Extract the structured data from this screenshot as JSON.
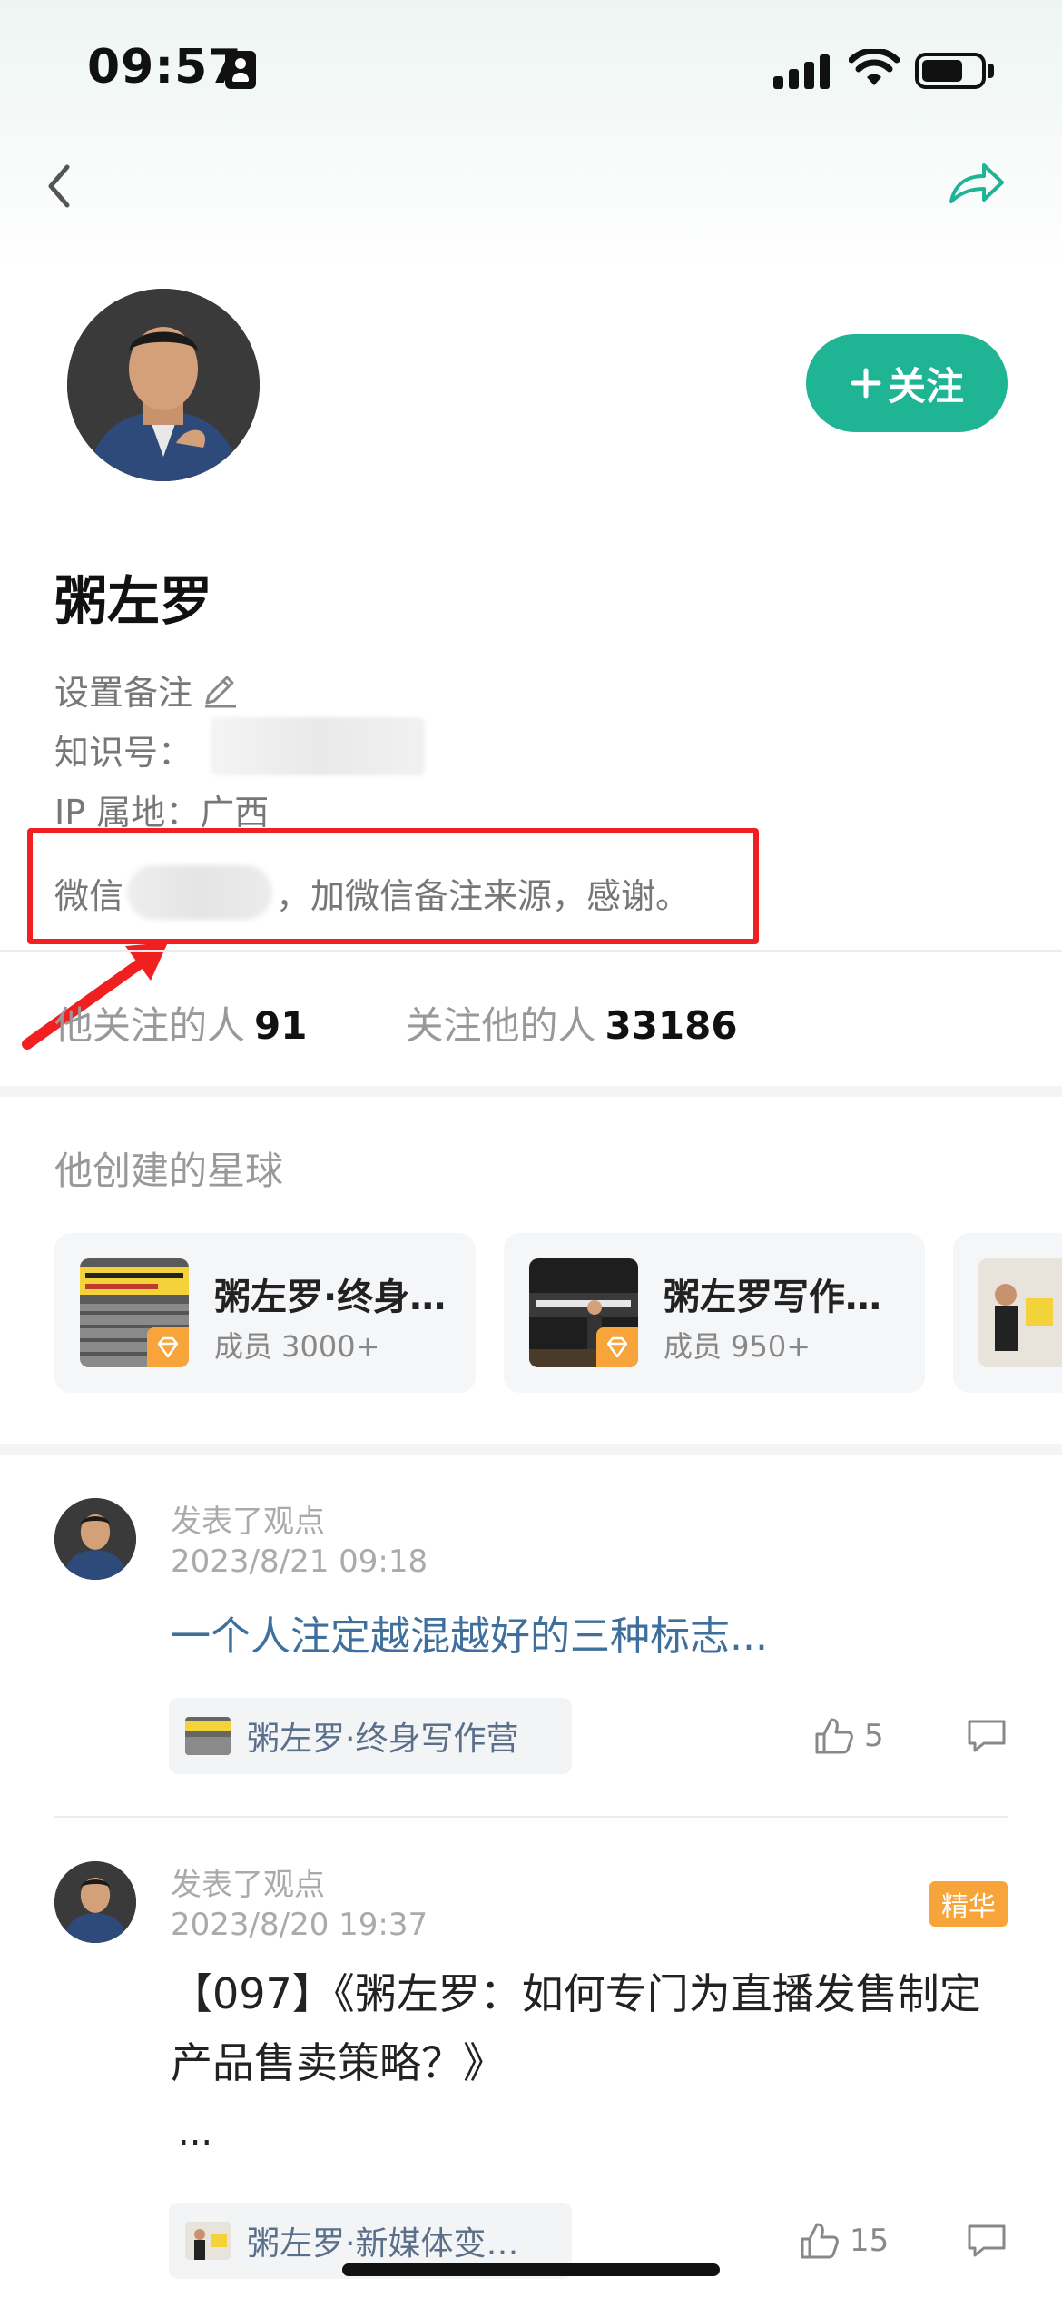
{
  "status_bar": {
    "time": "09:57"
  },
  "profile": {
    "name": "粥左罗",
    "follow_label": "关注",
    "remark_label": "设置备注",
    "zhishi_label": "知识号：",
    "ip_label": "IP 属地：广西",
    "wechat_prefix": "微信",
    "wechat_suffix": "，加微信备注来源，感谢。"
  },
  "stats": {
    "following_label": "他关注的人",
    "following_count": "91",
    "followers_label": "关注他的人",
    "followers_count": "33186"
  },
  "planets": {
    "title": "他创建的星球",
    "items": [
      {
        "name": "粥左罗·终身写作营",
        "members": "成员 3000+"
      },
      {
        "name": "粥左罗写作会员群",
        "members": "成员 950+"
      }
    ]
  },
  "posts": [
    {
      "action": "发表了观点",
      "time": "2023/8/21 09:18",
      "title": "一个人注定越混越好的三种标志...",
      "tag": "粥左罗·终身写作营",
      "likes": "5",
      "badge": ""
    },
    {
      "action": "发表了观点",
      "time": "2023/8/20 19:37",
      "title": "【097】《粥左罗：如何专门为直播发售制定产品售卖策略？》",
      "ellipsis": "...",
      "tag": "粥左罗·新媒体变现圈",
      "likes": "15",
      "badge": "精华"
    }
  ]
}
